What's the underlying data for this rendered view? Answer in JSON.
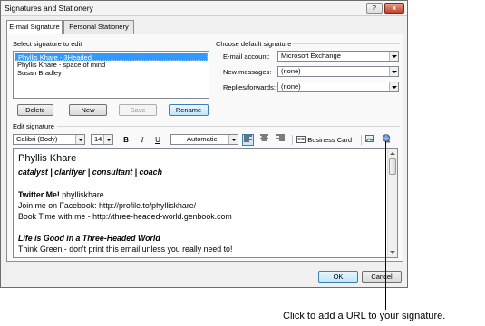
{
  "window": {
    "title": "Signatures and Stationery",
    "help_label": "?",
    "close_label": "x"
  },
  "tabs": [
    {
      "label": "E-mail Signature",
      "active": true
    },
    {
      "label": "Personal Stationery",
      "active": false
    }
  ],
  "select_signature": {
    "label": "Select signature to edit",
    "items": [
      "Phyllis Khare - 3Headed",
      "Phyllis Khare - space of mind",
      "Susan Bradley"
    ],
    "selected_index": 0,
    "buttons": {
      "delete": "Delete",
      "new": "New",
      "save": "Save",
      "rename": "Rename"
    }
  },
  "default_signature": {
    "label": "Choose default signature",
    "email_account_label": "E-mail account:",
    "email_account_value": "Microsoft Exchange",
    "new_messages_label": "New messages:",
    "new_messages_value": "(none)",
    "replies_label": "Replies/forwards:",
    "replies_value": "(none)"
  },
  "edit_signature": {
    "label": "Edit signature",
    "font": "Calibri (Body)",
    "size": "14",
    "bold": "B",
    "italic": "I",
    "underline": "U",
    "color": "Automatic",
    "business_card": "Business Card",
    "lines": [
      {
        "text": "Phyllis Khare"
      },
      {
        "text": "catalyst | clarifyer | consultant | coach"
      },
      {
        "bold_text": "Twitter Me!",
        "text": " phylliskhare"
      },
      {
        "text": "Join me on Facebook: http://profile.to/phylliskhare/"
      },
      {
        "text": "Book Time with me - http://three-headed-world.genbook.com"
      },
      {
        "text": "Life is Good in a Three-Headed World"
      },
      {
        "text": "Think Green - don't print this email unless you really need to!"
      }
    ]
  },
  "footer": {
    "ok": "OK",
    "cancel": "Cancel"
  },
  "annotation": "Click to add a URL to your signature.",
  "colors": {
    "selection": "#3399ff",
    "dialog_bg": "#f0f0f0",
    "close_red": "#c4402a"
  }
}
